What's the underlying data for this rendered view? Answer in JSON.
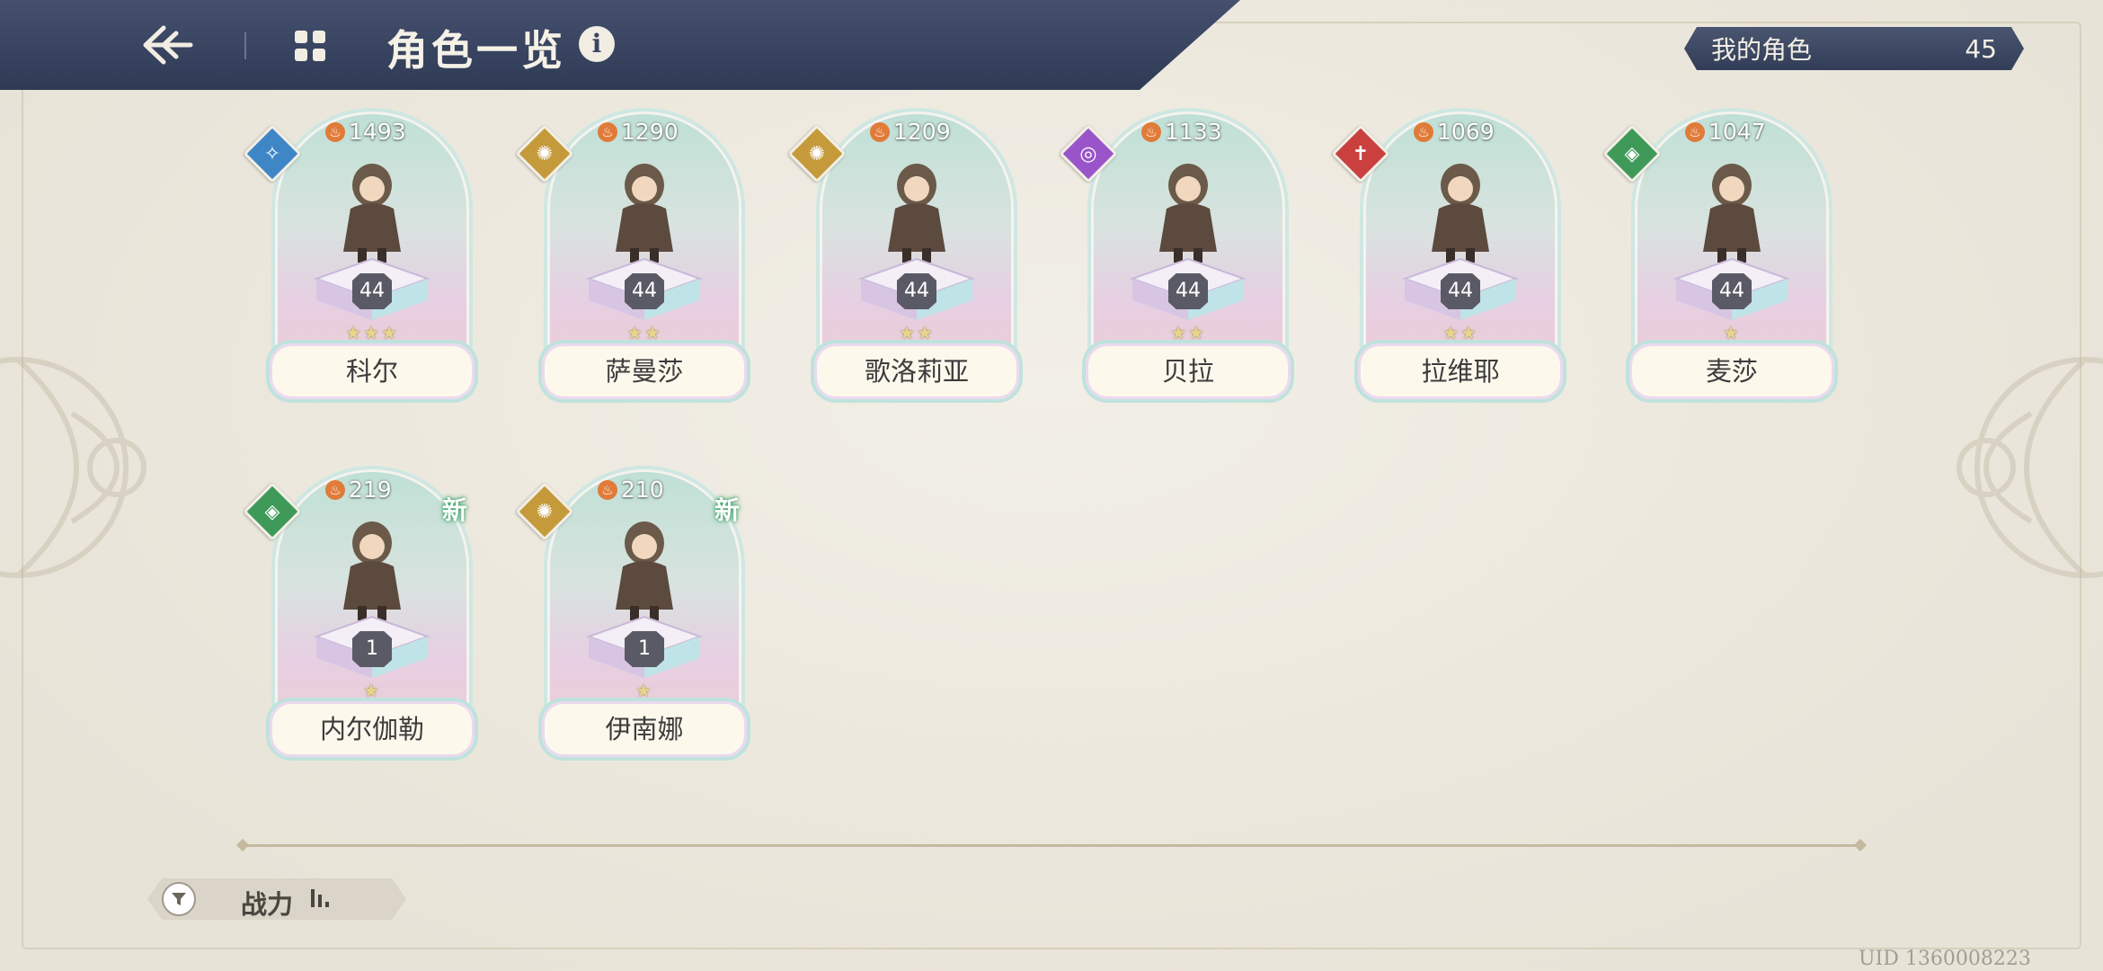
{
  "header": {
    "title": "角色一览",
    "info_icon": "i"
  },
  "my_roles": {
    "label": "我的角色",
    "count": "45"
  },
  "characters": [
    {
      "name": "科尔",
      "power": "1493",
      "level": "44",
      "stars": "★★★",
      "element": "blue",
      "is_new": false
    },
    {
      "name": "萨曼莎",
      "power": "1290",
      "level": "44",
      "stars": "★★",
      "element": "gold",
      "is_new": false
    },
    {
      "name": "歌洛莉亚",
      "power": "1209",
      "level": "44",
      "stars": "★★",
      "element": "gold",
      "is_new": false
    },
    {
      "name": "贝拉",
      "power": "1133",
      "level": "44",
      "stars": "★★",
      "element": "purple",
      "is_new": false
    },
    {
      "name": "拉维耶",
      "power": "1069",
      "level": "44",
      "stars": "★★",
      "element": "red",
      "is_new": false
    },
    {
      "name": "麦莎",
      "power": "1047",
      "level": "44",
      "stars": "★",
      "element": "green",
      "is_new": false
    },
    {
      "name": "内尔伽勒",
      "power": "219",
      "level": "1",
      "stars": "★",
      "element": "green",
      "is_new": true,
      "new_label": "新"
    },
    {
      "name": "伊南娜",
      "power": "210",
      "level": "1",
      "stars": "★",
      "element": "gold",
      "is_new": true,
      "new_label": "新"
    }
  ],
  "sort": {
    "label": "战力"
  },
  "uid": "UID 1360008223",
  "colors": {
    "header_bg": "#3a4560",
    "elem_blue": "#3f86c7",
    "elem_gold": "#c59a3b",
    "elem_purple": "#9a54c9",
    "elem_red": "#c9403f",
    "elem_green": "#3f9a5a"
  }
}
